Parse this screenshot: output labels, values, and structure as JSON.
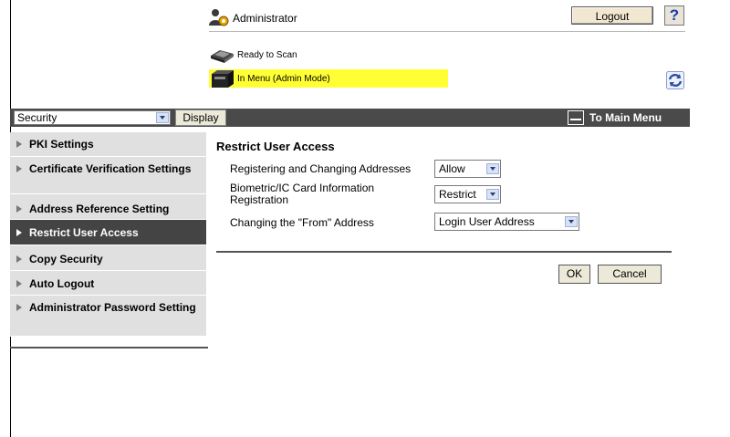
{
  "header": {
    "user_label": "Administrator",
    "logout_label": "Logout",
    "help_label": "?"
  },
  "status": {
    "scanner": "Ready to Scan",
    "mode": "In Menu (Admin Mode)",
    "mode_color": "#ffff33"
  },
  "toolbar": {
    "category_value": "Security",
    "display_label": "Display",
    "main_menu_label": "To Main Menu"
  },
  "sidebar": {
    "items": [
      {
        "label": "PKI Settings"
      },
      {
        "label": "Certificate Verification Settings"
      },
      {
        "label": "Address Reference Setting"
      },
      {
        "label": "Restrict User Access"
      },
      {
        "label": "Copy Security"
      },
      {
        "label": "Auto Logout"
      },
      {
        "label": "Administrator Password Setting"
      }
    ],
    "active_index": 3
  },
  "content": {
    "title": "Restrict User Access",
    "rows": [
      {
        "label": "Registering and Changing Addresses",
        "value": "Allow"
      },
      {
        "label": "Biometric/IC Card Information Registration",
        "value": "Restrict"
      },
      {
        "label": "Changing the \"From\" Address",
        "value": "Login User Address"
      }
    ],
    "ok_label": "OK",
    "cancel_label": "Cancel"
  },
  "icons": {
    "admin": "admin-user-icon",
    "scanner": "scanner-icon",
    "machine": "machine-status-icon",
    "refresh": "refresh-icon",
    "main_menu": "main-menu-icon"
  },
  "colors": {
    "dark_bar": "#4a4a4a",
    "sidebar_bg": "#e0e0e0",
    "sidebar_active": "#444444",
    "button_face": "#ece9d8"
  }
}
